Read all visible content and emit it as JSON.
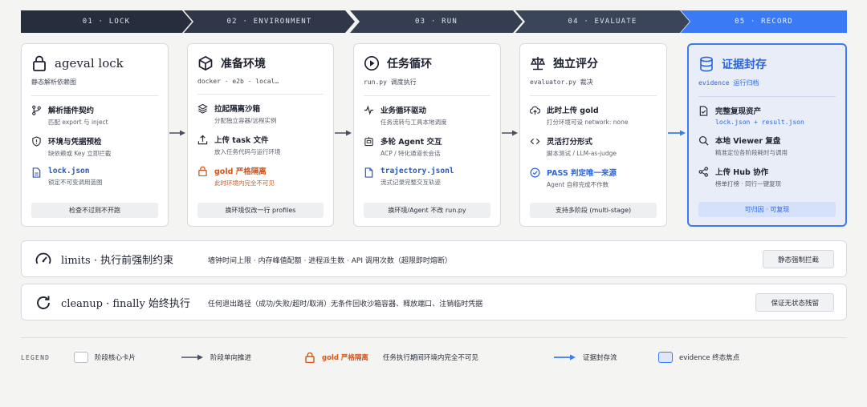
{
  "stages": [
    "01 · LOCK",
    "02 · ENVIRONMENT",
    "03 · RUN",
    "04 · EVALUATE",
    "05 · RECORD"
  ],
  "cards": [
    {
      "icon": "lock-icon",
      "title": "ageval lock",
      "subtitle": "静态解析依赖图",
      "items": [
        {
          "icon": "branch-icon",
          "title": "解析插件契约",
          "desc": "匹配 export 与 inject"
        },
        {
          "icon": "shield-alert-icon",
          "title": "环境与凭据预检",
          "desc": "缺依赖或 Key 立即拦截"
        },
        {
          "icon": "file-icon",
          "title": "lock.json",
          "desc": "锁定不可变调用蓝图"
        }
      ],
      "footer": "检查不过则不开跑"
    },
    {
      "icon": "cube-icon",
      "title": "准备环境",
      "subtitle": "docker · e2b · local…",
      "items": [
        {
          "icon": "layers-icon",
          "title": "拉起隔离沙箱",
          "desc": "分配独立容器/远程实例"
        },
        {
          "icon": "upload-icon",
          "title": "上传 task 文件",
          "desc": "放入任务代码与运行环境"
        },
        {
          "icon": "lock-icon",
          "title": "gold 严格隔离",
          "desc": "此时环境内完全不可见"
        }
      ],
      "footer": "换环境仅改一行 profiles"
    },
    {
      "icon": "play-circle-icon",
      "title": "任务循环",
      "subtitle": "run.py 调度执行",
      "items": [
        {
          "icon": "activity-icon",
          "title": "业务循环驱动",
          "desc": "任务流转与工具本地调度"
        },
        {
          "icon": "bot-icon",
          "title": "多轮 Agent 交互",
          "desc": "ACP / 特化通道长会话"
        },
        {
          "icon": "file-icon",
          "title": "trajectory.jsonl",
          "desc": "流式记录完整交互轨迹"
        }
      ],
      "footer": "换环境/Agent 不改 run.py"
    },
    {
      "icon": "scale-icon",
      "title": "独立评分",
      "subtitle": "evaluator.py 裁决",
      "items": [
        {
          "icon": "upload-cloud-icon",
          "title": "此时上传 gold",
          "desc": "打分环境可设 network: none"
        },
        {
          "icon": "code-icon",
          "title": "灵活打分形式",
          "desc": "脚本测试 / LLM-as-judge"
        },
        {
          "icon": "check-circle-icon",
          "title": "PASS 判定唯一来源",
          "desc": "Agent 自称完成不作数"
        }
      ],
      "footer": "支持多阶段 (multi-stage)"
    },
    {
      "icon": "database-icon",
      "title": "证据封存",
      "subtitle": "evidence 运行归档",
      "items": [
        {
          "icon": "file-check-icon",
          "title": "完整复现资产",
          "desc": "lock.json + result.json"
        },
        {
          "icon": "search-icon",
          "title": "本地 Viewer 复盘",
          "desc": "精准定位各阶段耗时与调用"
        },
        {
          "icon": "share-icon",
          "title": "上传 Hub 协作",
          "desc": "榜单打榜 · 同行一键复现"
        }
      ],
      "footer": "可归因 · 可复现"
    }
  ],
  "rows": [
    {
      "icon": "gauge-icon",
      "title": "limits · 执行前强制约束",
      "desc": "墙钟时间上限 · 内存峰值配额 · 进程派生数 · API 调用次数（超限即时熔断）",
      "button": "静态强制拦截"
    },
    {
      "icon": "refresh-icon",
      "title": "cleanup · finally 始终执行",
      "desc": "任何退出路径（成功/失败/超时/取消）无条件回收沙箱容器、释放端口、注销临时凭据",
      "button": "保证无状态残留"
    }
  ],
  "legend": {
    "label": "LEGEND",
    "items": [
      "阶段核心卡片",
      "阶段单向推进",
      "gold 严格隔离",
      "任务执行期间环境内完全不可见",
      "证据封存流",
      "evidence 终态焦点"
    ]
  },
  "colors": {
    "accent": "#3a7af4",
    "dark": "#262d3d",
    "warning": "#d2571f",
    "code": "#2457c5"
  }
}
